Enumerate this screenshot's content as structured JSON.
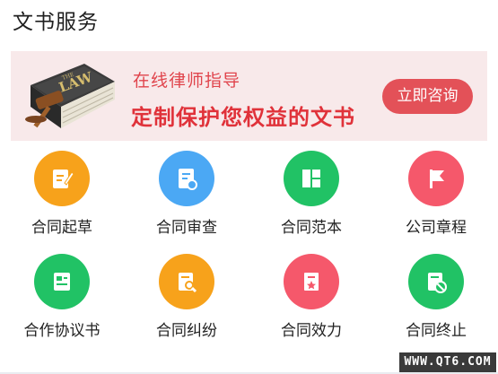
{
  "section_title": "文书服务",
  "banner": {
    "book_label": "LAW",
    "book_small": "THE",
    "subtitle": "在线律师指导",
    "headline": "定制保护您权益的文书",
    "button_label": "立即咨询"
  },
  "services": [
    {
      "label": "合同起草",
      "icon": "pencil-document-icon",
      "color": "#f7a21b"
    },
    {
      "label": "合同审查",
      "icon": "document-search-icon",
      "color": "#4ba8f4"
    },
    {
      "label": "合同范本",
      "icon": "template-grid-icon",
      "color": "#21c265"
    },
    {
      "label": "公司章程",
      "icon": "flag-icon",
      "color": "#f5586b"
    },
    {
      "label": "合作协议书",
      "icon": "agreement-document-icon",
      "color": "#21c265"
    },
    {
      "label": "合同纠纷",
      "icon": "document-magnifier-icon",
      "color": "#f7a21b"
    },
    {
      "label": "合同效力",
      "icon": "certificate-star-icon",
      "color": "#f5586b"
    },
    {
      "label": "合同终止",
      "icon": "document-stop-icon",
      "color": "#21c265"
    }
  ],
  "watermark": "WWW.QT6.COM"
}
